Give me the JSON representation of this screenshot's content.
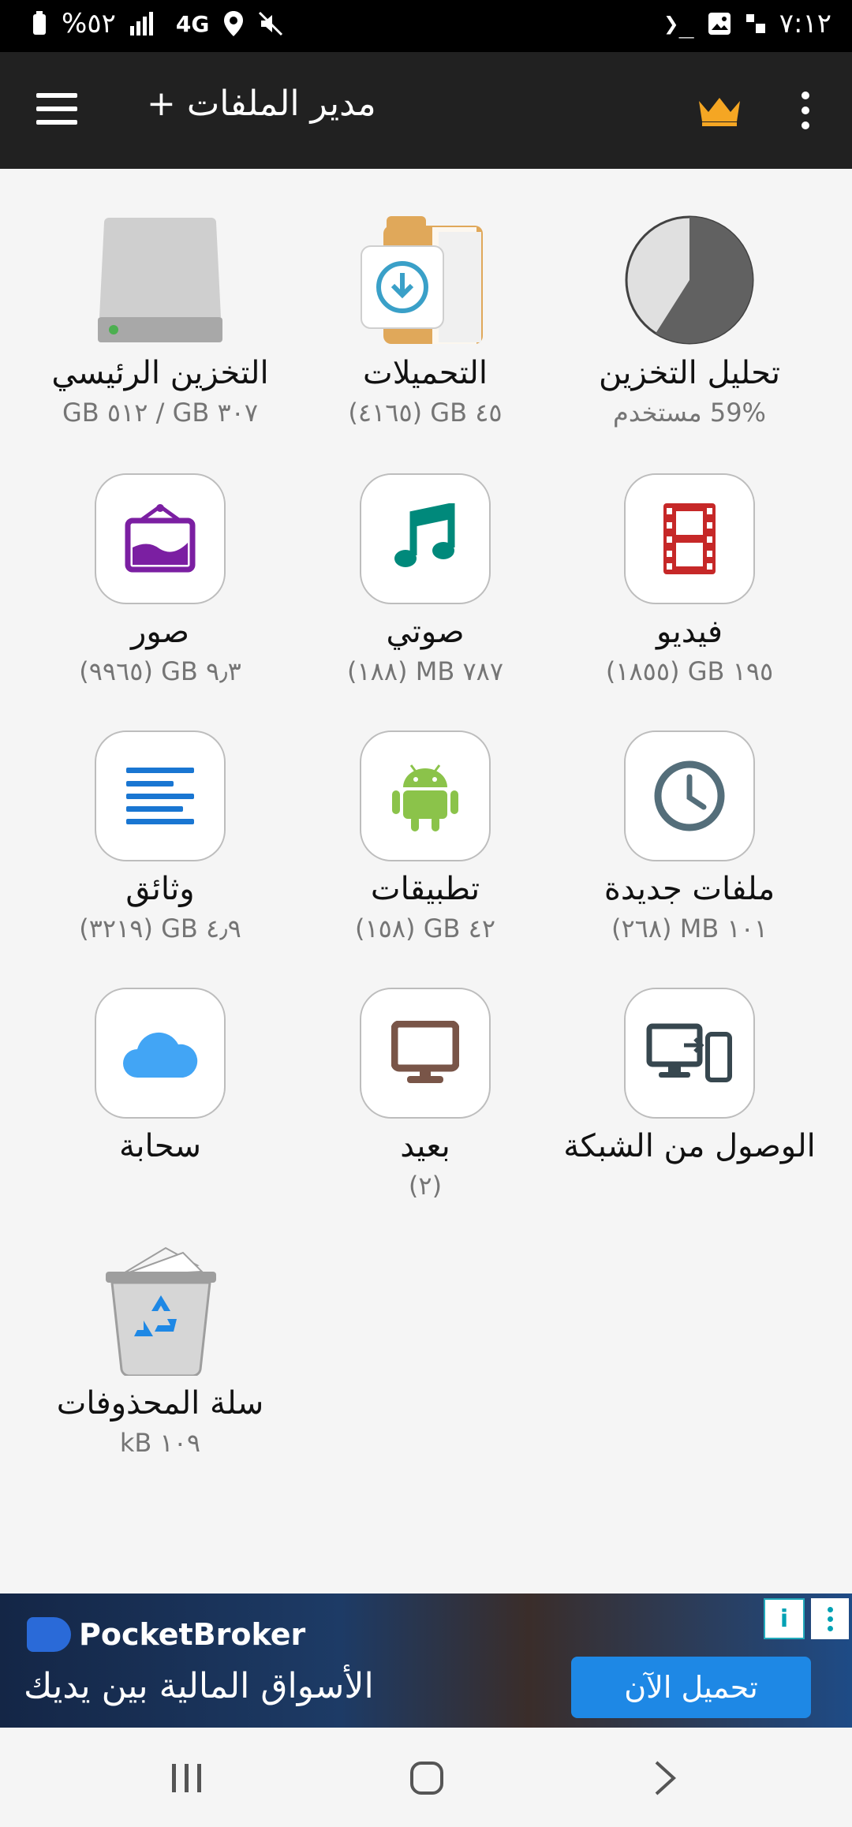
{
  "status_bar": {
    "time": "٧:١٢",
    "battery": "%٥٢",
    "network": "4G"
  },
  "app_bar": {
    "title": "مدير الملفات +",
    "menu_icon": "hamburger-menu-icon",
    "premium_icon": "crown-icon",
    "more_icon": "more-vert-icon"
  },
  "tiles": [
    {
      "id": "main-storage",
      "label": "التخزين الرئيسي",
      "sub": "٣٠٧ GB / ٥١٢ GB",
      "icon": "hard-drive-icon"
    },
    {
      "id": "downloads",
      "label": "التحميلات",
      "sub": "٤٥ GB (٤١٦٥)",
      "icon": "download-folder-icon"
    },
    {
      "id": "storage-analysis",
      "label": "تحليل التخزين",
      "sub": "59% مستخدم",
      "icon": "pie-chart-icon",
      "used_fraction": 0.59
    },
    {
      "id": "images",
      "label": "صور",
      "sub": "٩٫٣ GB (٩٩٦٥)",
      "icon": "image-icon"
    },
    {
      "id": "audio",
      "label": "صوتي",
      "sub": "٧٨٧ MB (١٨٨)",
      "icon": "music-note-icon"
    },
    {
      "id": "video",
      "label": "فيديو",
      "sub": "١٩٥ GB (١٨٥٥)",
      "icon": "film-icon"
    },
    {
      "id": "documents",
      "label": "وثائق",
      "sub": "٤٫٩ GB (٣٢١٩)",
      "icon": "document-lines-icon"
    },
    {
      "id": "apps",
      "label": "تطبيقات",
      "sub": "٤٢ GB (١٥٨)",
      "icon": "android-icon"
    },
    {
      "id": "recent",
      "label": "ملفات جديدة",
      "sub": "١٠١ MB (٢٦٨)",
      "icon": "clock-icon"
    },
    {
      "id": "cloud",
      "label": "سحابة",
      "sub": "",
      "icon": "cloud-icon"
    },
    {
      "id": "remote",
      "label": "بعيد",
      "sub": "(٢)",
      "icon": "monitor-icon"
    },
    {
      "id": "network-access",
      "label": "الوصول من الشبكة",
      "sub": "",
      "icon": "network-devices-icon"
    },
    {
      "id": "recycle-bin",
      "label": "سلة المحذوفات",
      "sub": "١٠٩ kB",
      "icon": "recycle-bin-icon"
    }
  ],
  "ad": {
    "brand": "PocketBroker",
    "tagline": "الأسواق المالية بين يديك",
    "cta": "تحميل الآن",
    "info": "i"
  },
  "colors": {
    "app_bar": "#212121",
    "accent_crown": "#f5a623",
    "images": "#7b1fa2",
    "audio": "#00897b",
    "video": "#c62828",
    "documents": "#1976d2",
    "apps": "#8bc34a",
    "recent": "#546e7a",
    "cloud": "#42a5f5",
    "remote": "#795548",
    "network": "#37474f"
  }
}
